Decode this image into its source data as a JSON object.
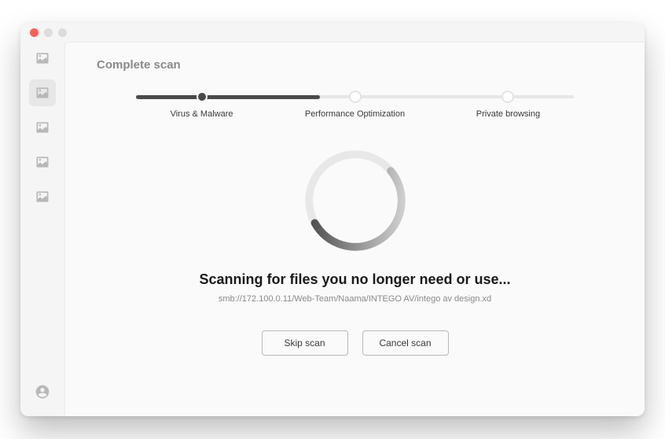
{
  "header": {
    "title": "Complete scan"
  },
  "sidebar": {
    "items": [
      {
        "icon": "image-icon",
        "active": false
      },
      {
        "icon": "image-icon",
        "active": true
      },
      {
        "icon": "image-icon",
        "active": false
      },
      {
        "icon": "image-icon",
        "active": false
      },
      {
        "icon": "image-icon",
        "active": false
      }
    ]
  },
  "stepper": {
    "progress_percent": 42,
    "steps": [
      {
        "label": "Virus & Malware",
        "position_percent": 15,
        "state": "done"
      },
      {
        "label": "Performance Optimization",
        "position_percent": 50,
        "state": "current"
      },
      {
        "label": "Private browsing",
        "position_percent": 85,
        "state": "pending"
      }
    ]
  },
  "scan": {
    "headline": "Scanning for files you no longer need or use...",
    "current_path": "smb://172.100.0.11/Web-Team/Naama/INTEGO AV/intego av design.xd"
  },
  "actions": {
    "skip_label": "Skip scan",
    "cancel_label": "Cancel scan"
  }
}
